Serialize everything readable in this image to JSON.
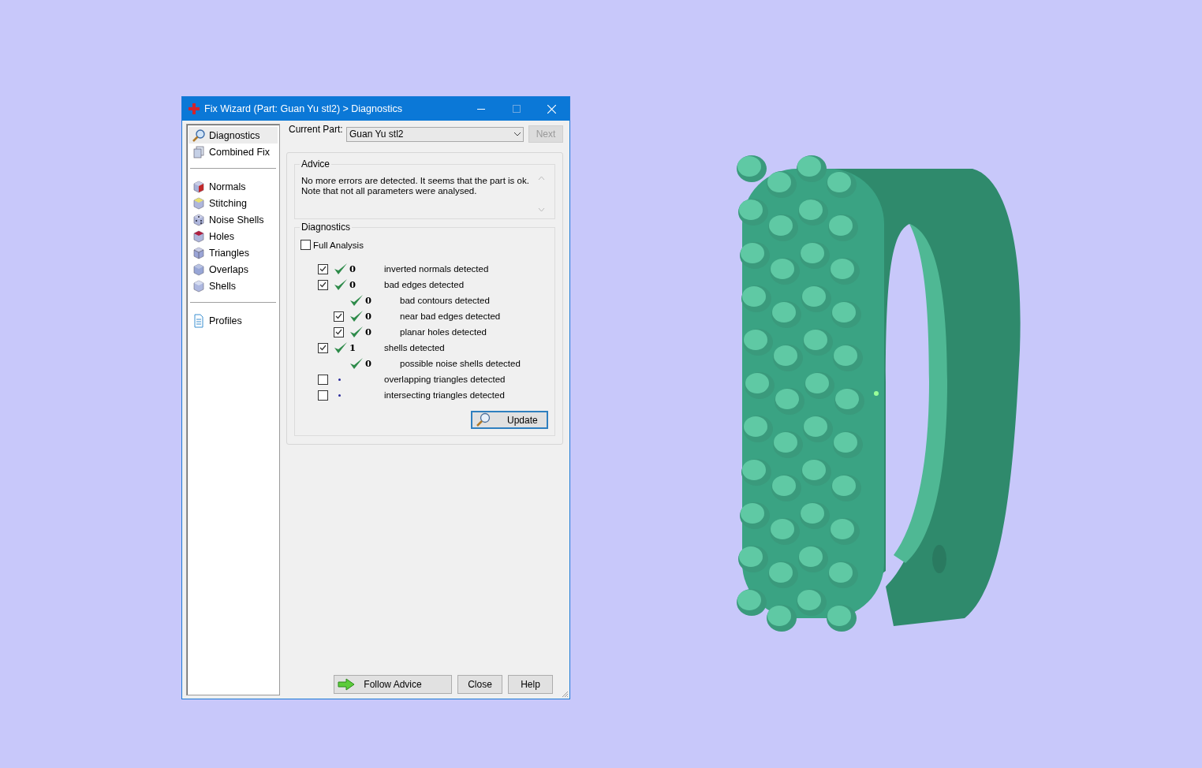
{
  "window": {
    "title": "Fix Wizard (Part: Guan Yu stl2) > Diagnostics"
  },
  "sidebar": {
    "groups": [
      [
        {
          "label": "Diagnostics",
          "selected": true
        },
        {
          "label": "Combined Fix",
          "selected": false
        }
      ],
      [
        {
          "label": "Normals",
          "selected": false
        },
        {
          "label": "Stitching",
          "selected": false
        },
        {
          "label": "Noise Shells",
          "selected": false
        },
        {
          "label": "Holes",
          "selected": false
        },
        {
          "label": "Triangles",
          "selected": false
        },
        {
          "label": "Overlaps",
          "selected": false
        },
        {
          "label": "Shells",
          "selected": false
        }
      ],
      [
        {
          "label": "Profiles",
          "selected": false
        }
      ]
    ]
  },
  "current_part": {
    "label": "Current Part:",
    "value": "Guan Yu stl2",
    "next_button": {
      "label": "Next",
      "disabled": true
    }
  },
  "advice": {
    "title": "Advice",
    "text": "No more errors are detected. It seems that the part is ok.\nNote that not all parameters were analysed."
  },
  "diagnostics": {
    "title": "Diagnostics",
    "full_analysis": {
      "label": "Full Analysis",
      "checked": false
    },
    "rows": [
      {
        "kind": "ok",
        "checked": true,
        "count": "0",
        "label": "inverted normals detected"
      },
      {
        "kind": "ok",
        "checked": true,
        "count": "0",
        "label": "bad edges detected",
        "children": [
          {
            "kind": "ok",
            "count": "0",
            "label": "bad contours detected"
          },
          {
            "kind": "ok",
            "checked": true,
            "count": "0",
            "label": "near bad edges detected"
          },
          {
            "kind": "ok",
            "checked": true,
            "count": "0",
            "label": "planar holes detected"
          }
        ]
      },
      {
        "kind": "ok",
        "checked": true,
        "count": "1",
        "label": "shells detected",
        "children": [
          {
            "kind": "ok",
            "count": "0",
            "label": "possible noise shells detected"
          }
        ]
      },
      {
        "kind": "pending",
        "checked": false,
        "label": "overlapping triangles detected"
      },
      {
        "kind": "pending",
        "checked": false,
        "label": "intersecting triangles detected"
      }
    ],
    "update_button": "Update"
  },
  "footer_buttons": [
    {
      "label": "Follow Advice",
      "kind": "arrow"
    },
    {
      "label": "Close",
      "kind": "plain"
    },
    {
      "label": "Help",
      "kind": "plain"
    }
  ]
}
